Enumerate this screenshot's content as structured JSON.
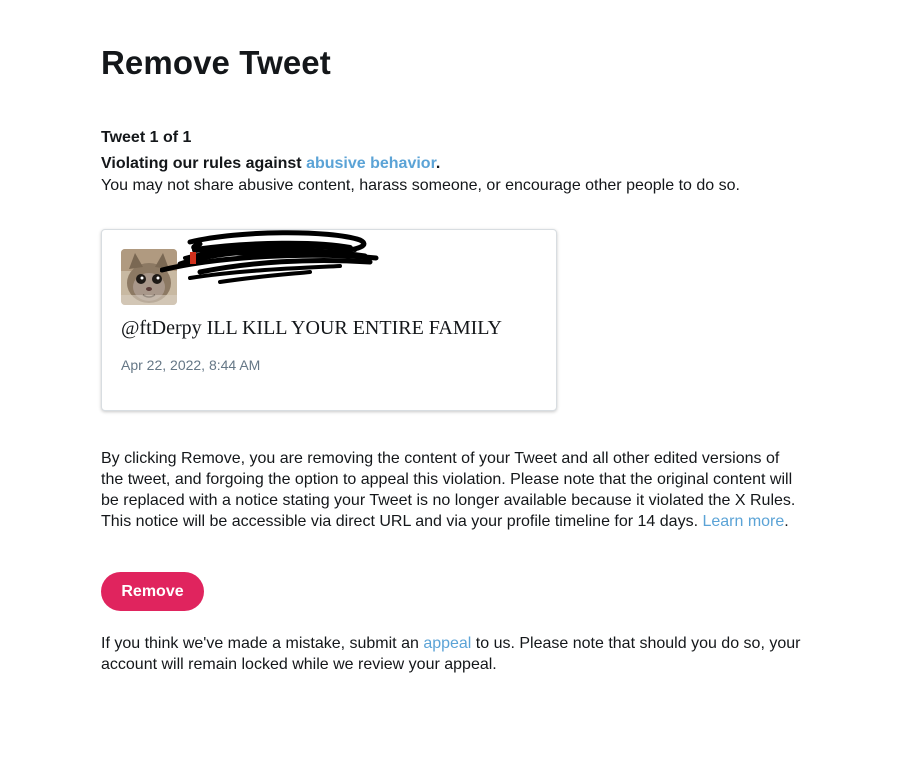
{
  "page": {
    "title": "Remove Tweet",
    "counter": "Tweet 1 of 1",
    "violation_prefix": "Violating our rules against ",
    "violation_link": "abusive behavior",
    "violation_suffix": ".",
    "rule_description": "You may not share abusive content, harass someone, or encourage other people to do so."
  },
  "tweet": {
    "avatar_icon": "cat-photo-avatar",
    "author_redacted": true,
    "text": "@ftDerpy ILL KILL YOUR ENTIRE FAMILY",
    "timestamp": "Apr 22, 2022, 8:44 AM"
  },
  "notice": {
    "body": "By clicking Remove, you are removing the content of your Tweet and all other edited versions of the tweet, and forgoing the option to appeal this violation. Please note that the original content will be replaced with a notice stating your Tweet is no longer available because it violated the X Rules. This notice will be accessible via direct URL and via your profile timeline for 14 days. ",
    "learn_more": "Learn more",
    "end": "."
  },
  "actions": {
    "remove_label": "Remove"
  },
  "appeal": {
    "prefix": "If you think we've made a mistake, submit an ",
    "link": "appeal",
    "suffix": " to us. Please note that should you do so, your account will remain locked while we review your appeal."
  },
  "colors": {
    "link": "#5ba3d6",
    "remove_button": "#e0245e",
    "text": "#14171a",
    "muted": "#657786"
  }
}
